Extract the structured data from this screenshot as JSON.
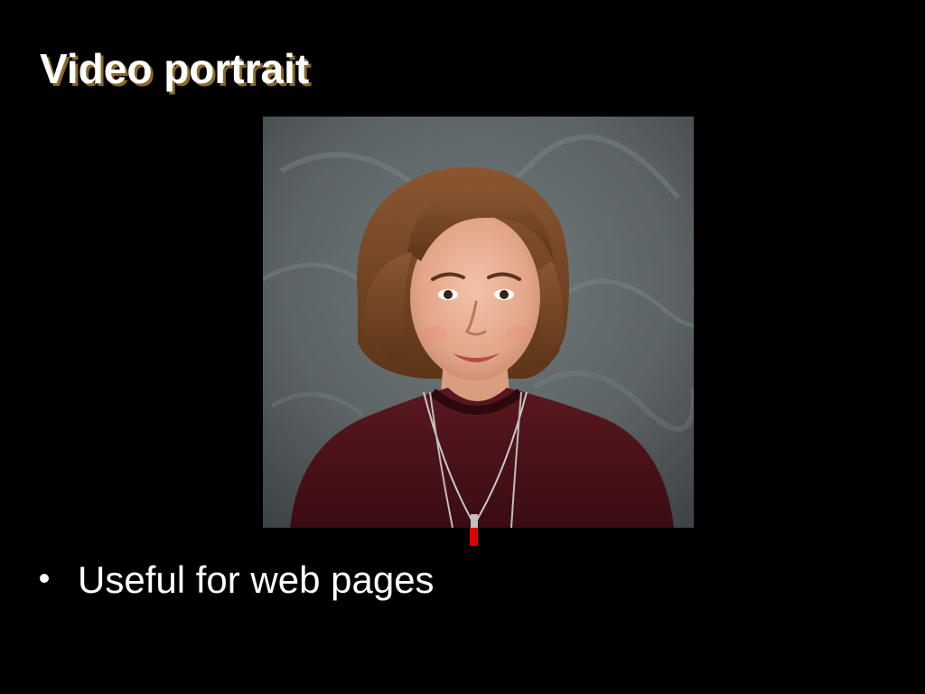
{
  "slide": {
    "title": "Video portrait",
    "bullets": [
      {
        "text": "Useful for web pages"
      }
    ]
  },
  "colors": {
    "background": "#000000",
    "title_text": "#ffffff",
    "title_shadow": "#8a6a2a",
    "bullet_text": "#ffffff",
    "portrait_backdrop": "#5f6668",
    "sweater": "#4a1218",
    "hair": "#7a4a26",
    "pendant": "#e00000"
  },
  "icons": {
    "bullet": "bullet-dot-icon"
  }
}
